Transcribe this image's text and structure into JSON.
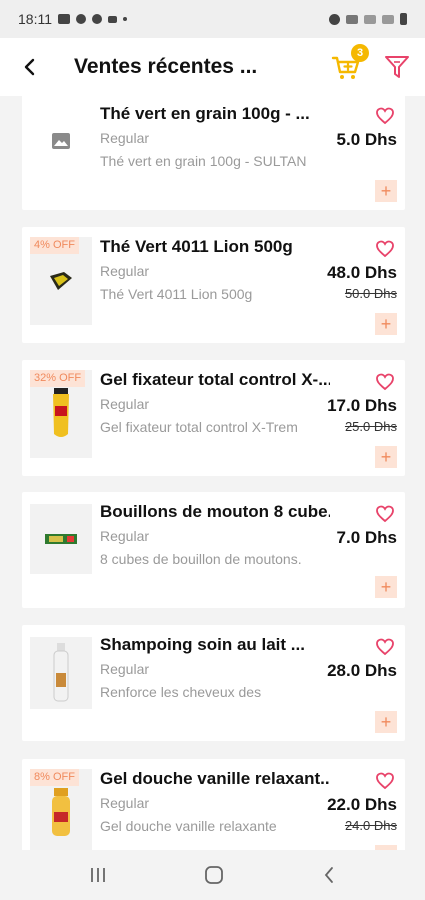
{
  "status_bar": {
    "time": "18:11"
  },
  "header": {
    "title": "Ventes récentes ...",
    "cart_count": "3"
  },
  "colors": {
    "accent": "#f5b800",
    "pink": "#e8436a",
    "badge_bg": "#fde3d6",
    "badge_text": "#f08a5d"
  },
  "products": [
    {
      "name": "Thé vert en grain 100g - ...",
      "type": "Regular",
      "desc": "Thé vert en grain 100g - SULTAN",
      "price": "5.0 Dhs"
    },
    {
      "discount": "4% OFF",
      "name": "Thé Vert 4011 Lion 500g",
      "type": "Regular",
      "desc": "Thé Vert 4011 Lion 500g",
      "price": "48.0 Dhs",
      "old_price": "50.0 Dhs"
    },
    {
      "discount": "32% OFF",
      "name": "Gel fixateur total control X-...",
      "type": "Regular",
      "desc": "Gel fixateur total control X-Trem",
      "price": "17.0 Dhs",
      "old_price": "25.0 Dhs"
    },
    {
      "name": "Bouillons de mouton 8 cube...",
      "type": "Regular",
      "desc": "8 cubes de bouillon de moutons.",
      "price": "7.0 Dhs"
    },
    {
      "name": "Shampoing soin au lait ...",
      "type": "Regular",
      "desc": "Renforce les cheveux des",
      "price": "28.0 Dhs"
    },
    {
      "discount": "8% OFF",
      "name": "Gel douche vanille relaxant...",
      "type": "Regular",
      "desc": "Gel douche vanille relaxante",
      "price": "22.0 Dhs",
      "old_price": "24.0 Dhs"
    }
  ]
}
